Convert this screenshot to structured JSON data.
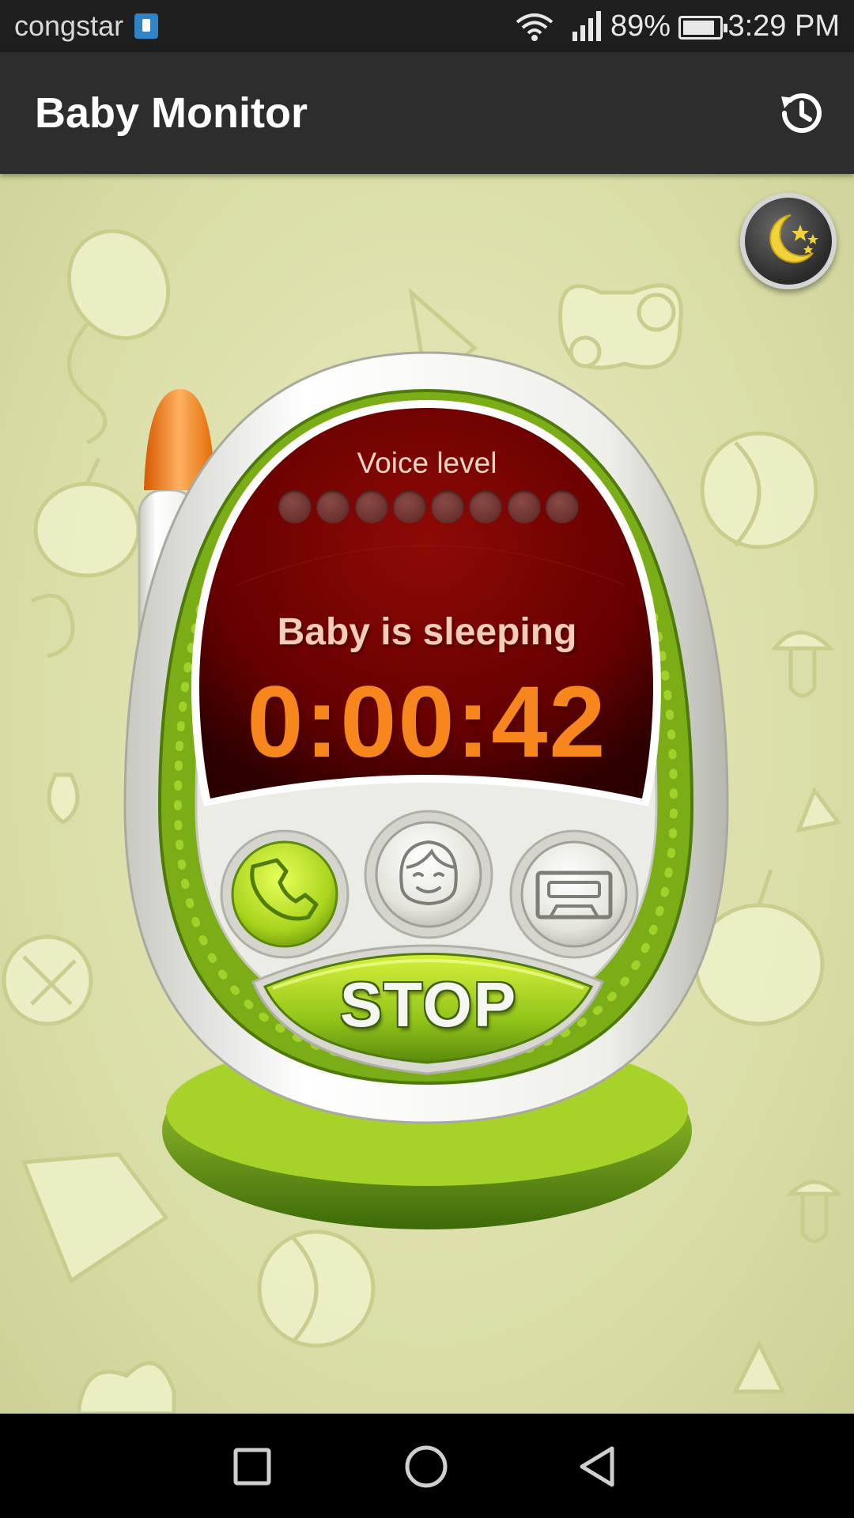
{
  "status_bar": {
    "carrier": "congstar",
    "battery_percent": "89%",
    "battery_level": 0.89,
    "time": "3:29 PM",
    "icons": [
      "sim-icon",
      "wifi-icon",
      "signal-icon",
      "battery-icon"
    ]
  },
  "app_bar": {
    "title": "Baby Monitor",
    "action_icon": "history-icon"
  },
  "monitor": {
    "night_mode_icon": "moon-stars-icon",
    "voice_level_label": "Voice level",
    "voice_level_active": 0,
    "voice_level_total": 8,
    "status_text": "Baby is sleeping",
    "timer": "0:00:42",
    "buttons": {
      "call_icon": "phone-icon",
      "parent_icon": "face-icon",
      "record_icon": "cassette-icon",
      "stop_label": "STOP"
    }
  },
  "nav_bar": {
    "icons": [
      "recents-icon",
      "home-icon",
      "back-icon"
    ]
  },
  "colors": {
    "accent_orange": "#f7871c",
    "screen_red": "#6a0000",
    "device_green": "#8fc21e",
    "background": "#dfe1ad"
  }
}
